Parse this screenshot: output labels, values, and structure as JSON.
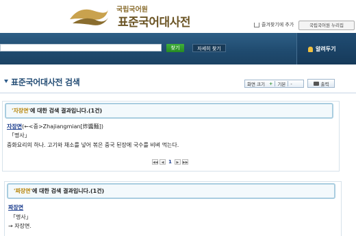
{
  "header": {
    "logo_top": "국립국어원",
    "logo_title": "표준국어대사전",
    "bookmark_label": "즐겨찾기에 추가",
    "site_link_label": "국립국어원 누리집"
  },
  "search": {
    "input_value": "",
    "search_button": "찾기",
    "advanced_button": "자세히 찾기",
    "notice_label": "알려두기"
  },
  "section": {
    "title": "표준국어대사전 검색",
    "zoom_label": "화면 크기",
    "zoom_plus": "+",
    "zoom_default": "기본",
    "zoom_minus": "-",
    "print_label": "출력"
  },
  "results": [
    {
      "query": "'자장면'",
      "summary": "에 대한 검색 결과입니다.(1건)",
      "headword": "자장면",
      "origin": "(←<중>Zhajiangmian[炸醬麵])",
      "pos": "「명사」",
      "definition": "중화요리의 하나. 고기와 채소를 넣어 볶은 중국 된장에 국수를 비벼 먹는다.",
      "pager": {
        "first": "◀◀",
        "prev": "◀",
        "current": "1",
        "next": "▶",
        "last": "▶▶"
      }
    },
    {
      "query": "'짜장면'",
      "summary": "에 대한 검색 결과입니다.(1건)",
      "headword": "짜장면",
      "pos": "「명사」",
      "reference": "→ 자장면."
    }
  ]
}
